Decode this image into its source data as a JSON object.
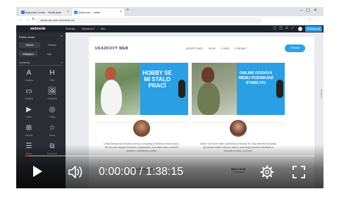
{
  "browser": {
    "tabs": [
      {
        "title": "Mapování webu · SiteBuilder",
        "active": false
      },
      {
        "title": "Webnode – editor",
        "active": true
      }
    ],
    "url": "ukazkovy-web.webnode.cz/"
  },
  "editor": {
    "logo": "webnode",
    "menu": [
      "Stránky",
      "Nastavení",
      "Info"
    ],
    "publish_label": "Publikovat"
  },
  "sidebar": {
    "title": "Přidat obsah",
    "tabs": [
      "Sekce",
      "Obsah"
    ],
    "subtabs": [
      "Základní",
      "Vše"
    ],
    "search_placeholder": "Vyhledat",
    "items": [
      {
        "glyph": "A",
        "label": "Nadpis"
      },
      {
        "glyph": "H",
        "label": "Text"
      },
      {
        "glyph": "▭",
        "label": "Tlačítko"
      },
      {
        "glyph": "🖼",
        "label": "Obrázek"
      },
      {
        "glyph": "▶",
        "label": "Video"
      },
      {
        "glyph": "◎",
        "label": "Fotka"
      },
      {
        "glyph": "⊞",
        "label": "Galerie"
      },
      {
        "glyph": "☆",
        "label": "Ikona"
      },
      {
        "glyph": "☰",
        "label": "Menu"
      },
      {
        "glyph": "⧉",
        "label": "Formulář"
      }
    ]
  },
  "page": {
    "logo": "UKÁZKOVÝ WEB",
    "menu": [
      "KOUPIT KURZ",
      "BLOG",
      "O NÁS",
      "KONTAKT"
    ],
    "button": "Přihlásit",
    "banners": [
      {
        "text": "HOBBY SE MI STALO PRACÍ"
      },
      {
        "text": "ONLINE DODÁVÁ MÉMU PODNIKÁNÍ STABILITU"
      }
    ],
    "cards": [
      {
        "text": "Lenka Šafránová, lektorka kurzů pro fotografy, je lektorkou tohoto kurzu. Ve své práci spojuje kreativitu s podnikáním a pomáhá lidem proměnit koníček v udržitelnou profesi.",
        "name": "Lenka Šafránová",
        "role": "Lektorka kurzu"
      },
      {
        "text": "Marie Holá vede online podnikání již několik let. Díky internetu dokázala vybudovat stabilní zázemí, které jí umožňuje pracovat odkudkoliv a věnovat se tomu, co ji baví.",
        "name": "Marie Holá",
        "role": "Podnikatelka"
      }
    ]
  },
  "video": {
    "current_time": "0:00:00",
    "duration": "1:38:15",
    "time_separator": " / ",
    "progress_fraction": 0.0,
    "accent_color": "#ff0000"
  }
}
